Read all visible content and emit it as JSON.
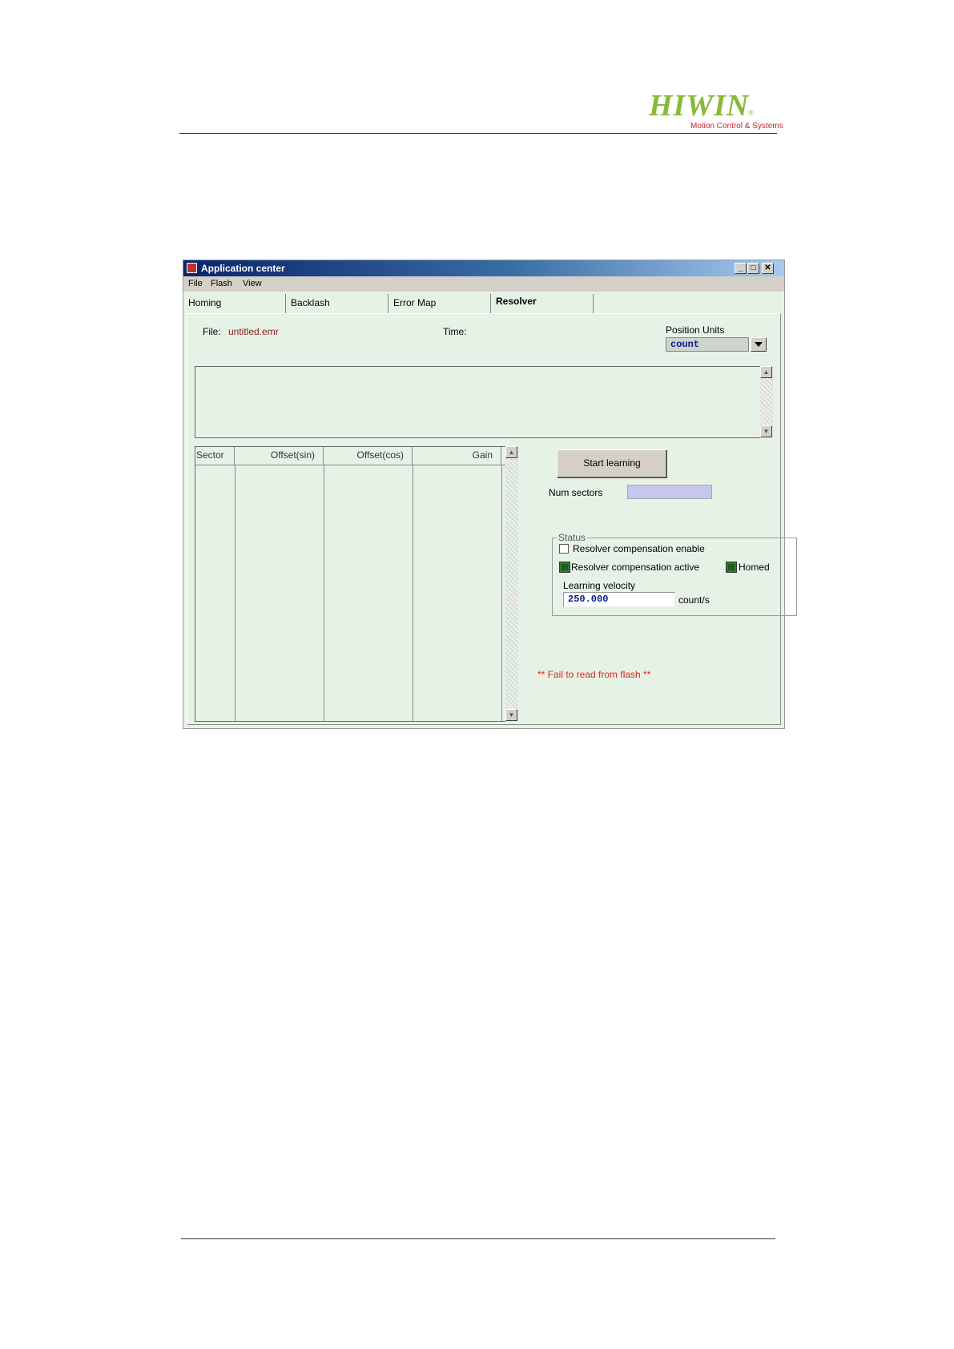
{
  "logo": {
    "brand": "HIWIN",
    "registered": "®",
    "tagline": "Motion Control & Systems"
  },
  "window": {
    "title": "Application center",
    "title_buttons": {
      "minimize": "_",
      "maximize": "□",
      "close": "✕"
    }
  },
  "menu": [
    "File",
    "Flash",
    "View"
  ],
  "tabs": [
    {
      "label": "Homing",
      "active": false
    },
    {
      "label": "Backlash",
      "active": false
    },
    {
      "label": "Error Map",
      "active": false
    },
    {
      "label": "Resolver",
      "active": true
    }
  ],
  "file": {
    "label": "File:",
    "value": "untitled.emr"
  },
  "time": {
    "label": "Time:",
    "value": ""
  },
  "position_units": {
    "label": "Position Units",
    "selected": "count"
  },
  "table": {
    "columns": [
      "Sector",
      "Offset(sin)",
      "Offset(cos)",
      "Gain"
    ],
    "rows": []
  },
  "start_button": "Start learning",
  "num_sectors": {
    "label": "Num sectors",
    "value": ""
  },
  "status": {
    "title": "Status",
    "comp_enable": {
      "label": "Resolver compensation enable",
      "checked": false
    },
    "comp_active": {
      "label": "Resolver compensation active",
      "on": true
    },
    "homed": {
      "label": "Homed",
      "on": true
    },
    "velocity": {
      "label": "Learning velocity",
      "value": "250.000",
      "unit": "count/s"
    }
  },
  "message": "** Fail to read from flash **",
  "colors": {
    "accent_green": "#8ab83a",
    "error_red": "#e0261e",
    "panel_bg": "#e7f2e7",
    "field_blue": "#c6c6ee"
  }
}
